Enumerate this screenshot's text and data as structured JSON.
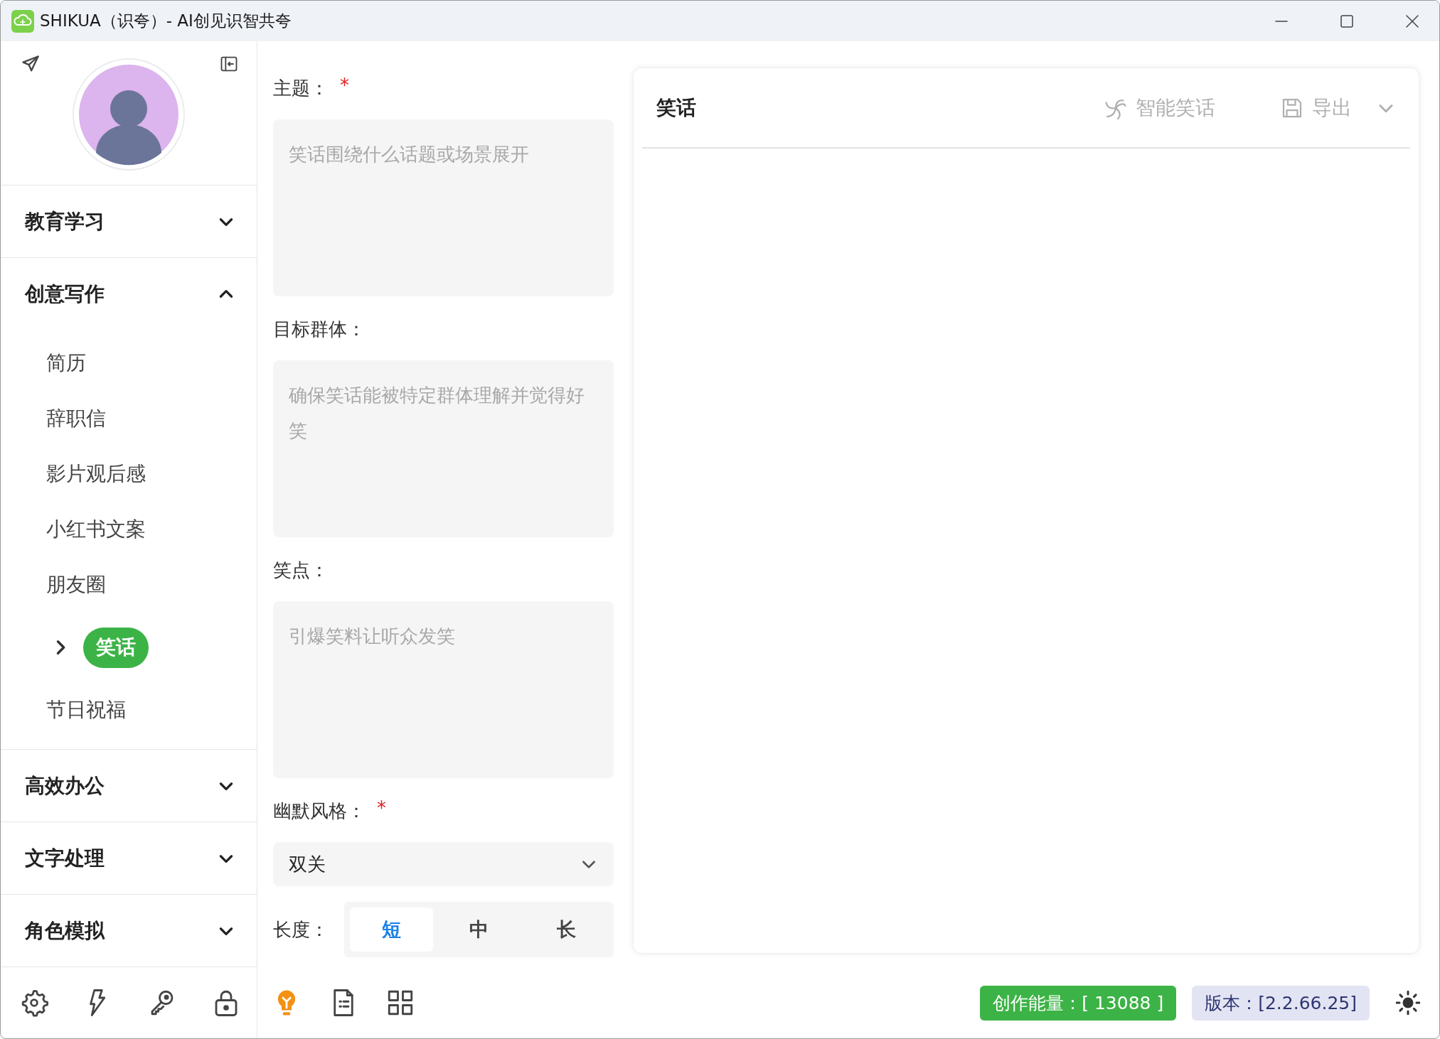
{
  "window": {
    "title": "SHIKUA（识夸）- AI创见识智共夸"
  },
  "sidebar": {
    "categories": [
      {
        "label": "教育学习",
        "expanded": false
      },
      {
        "label": "创意写作",
        "expanded": true,
        "items": [
          {
            "label": "简历",
            "selected": false
          },
          {
            "label": "辞职信",
            "selected": false
          },
          {
            "label": "影片观后感",
            "selected": false
          },
          {
            "label": "小红书文案",
            "selected": false
          },
          {
            "label": "朋友圈",
            "selected": false
          },
          {
            "label": "笑话",
            "selected": true
          },
          {
            "label": "节日祝福",
            "selected": false
          }
        ]
      },
      {
        "label": "高效办公",
        "expanded": false
      },
      {
        "label": "文字处理",
        "expanded": false
      },
      {
        "label": "角色模拟",
        "expanded": false
      }
    ]
  },
  "form": {
    "fields": [
      {
        "kind": "textarea",
        "label": "主题：",
        "required_mark": "*",
        "placeholder": "笑话围绕什么话题或场景展开"
      },
      {
        "kind": "textarea",
        "label": "目标群体：",
        "placeholder": "确保笑话能被特定群体理解并觉得好笑"
      },
      {
        "kind": "textarea",
        "label": "笑点：",
        "placeholder": "引爆笑料让听众发笑"
      },
      {
        "kind": "select",
        "label": "幽默风格：",
        "required_mark": "*",
        "value": "双关"
      },
      {
        "kind": "segmented",
        "label": "长度：",
        "options": [
          {
            "label": "短",
            "selected": true
          },
          {
            "label": "中",
            "selected": false
          },
          {
            "label": "长",
            "selected": false
          }
        ]
      }
    ]
  },
  "output": {
    "title": "笑话",
    "actions": [
      {
        "kind": "ai",
        "label": "智能笑话",
        "disabled": true
      },
      {
        "kind": "export",
        "label": "导出",
        "disabled": true
      }
    ]
  },
  "tools": [
    {
      "kind": "bulb",
      "selected": true
    },
    {
      "kind": "document",
      "selected": false
    },
    {
      "kind": "grid",
      "selected": false
    }
  ],
  "status_bar": {
    "energy": "创作能量：[ 13088 ]",
    "version": "版本：[2.2.66.25]"
  }
}
